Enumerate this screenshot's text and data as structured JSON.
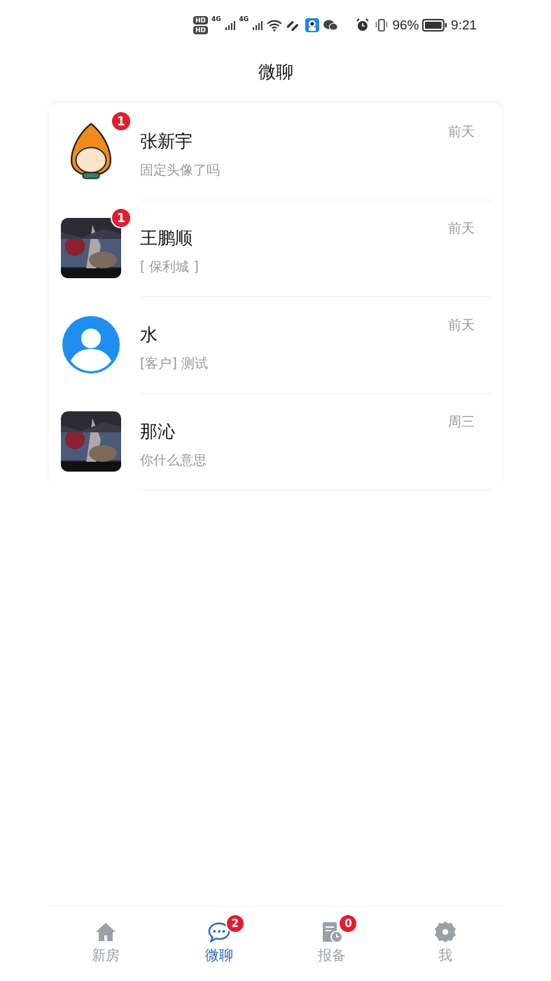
{
  "status_bar": {
    "sim_labels": [
      "HD",
      "HD"
    ],
    "network_labels": [
      "4G",
      "4G"
    ],
    "battery": "96%",
    "time": "9:21"
  },
  "title": "微聊",
  "conversations": [
    {
      "avatar": {
        "kind": "cartoon"
      },
      "badge": "1",
      "name": "张新宇",
      "preview": "固定头像了吗",
      "time": "前天"
    },
    {
      "badge": "1",
      "name": "王鹏顺",
      "preview": "[ 保利城 ]",
      "time": "前天"
    },
    {
      "avatar": {
        "kind": "default"
      },
      "name": "水",
      "preview": "[客户] 测试",
      "time": "前天"
    },
    {
      "name": "那沁",
      "preview": "你什么意思",
      "time": "周三"
    }
  ],
  "tabs": [
    {
      "kind": "home",
      "label": "新房",
      "selected": false
    },
    {
      "kind": "chat",
      "label": "微聊",
      "selected": true,
      "badge": "2"
    },
    {
      "kind": "report",
      "label": "报备",
      "selected": false,
      "badge": "0"
    },
    {
      "kind": "settings",
      "label": "我",
      "selected": false
    }
  ]
}
